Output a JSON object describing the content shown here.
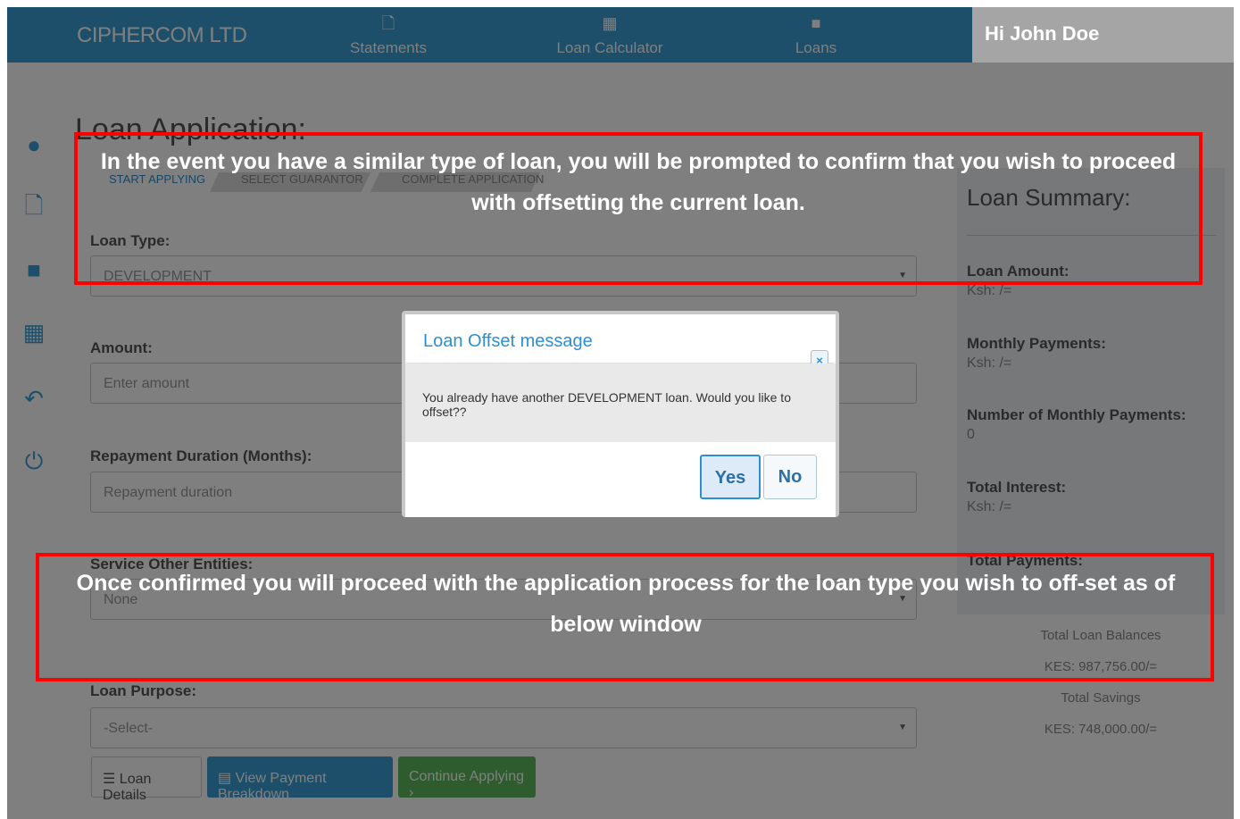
{
  "navbar": {
    "brand": "CIPHERCOM LTD",
    "items": [
      {
        "label": "Statements",
        "icon": "document-icon"
      },
      {
        "label": "Loan Calculator",
        "icon": "calculator-icon"
      },
      {
        "label": "Loans",
        "icon": "briefcase-icon"
      }
    ],
    "greeting": "Hi John Doe"
  },
  "sidebar": {
    "icons": [
      "palette-icon",
      "document-icon",
      "briefcase-icon",
      "dashboard-icon",
      "undo-icon",
      "power-icon"
    ]
  },
  "form": {
    "title": "Loan Application:",
    "steps": [
      "START APPLYING",
      "SELECT GUARANTOR",
      "COMPLETE APPLICATION"
    ],
    "loan_type_label": "Loan Type:",
    "loan_type_value": "DEVELOPMENT",
    "amount_label": "Amount:",
    "amount_placeholder": "Enter amount",
    "duration_label": "Repayment Duration (Months):",
    "duration_placeholder": "Repayment duration",
    "service_label": "Service Other Entities:",
    "service_value": "None",
    "purpose_label": "Loan Purpose:",
    "purpose_value": "-Select-",
    "buttons": {
      "loan_details": "Loan Details",
      "view_breakdown": "View Payment Breakdown",
      "continue": "Continue Applying ›"
    }
  },
  "summary": {
    "title": "Loan Summary:",
    "loan_amount_label": "Loan Amount:",
    "loan_amount_value": "Ksh: /=",
    "monthly_label": "Monthly Payments:",
    "monthly_value": "Ksh: /=",
    "count_label": "Number of Monthly Payments:",
    "count_value": "0",
    "interest_label": "Total Interest:",
    "interest_value": "Ksh: /=",
    "total_label": "Total Payments:",
    "balances_label": "Total Loan Balances",
    "balances_value": "KES: 987,756.00/=",
    "savings_label": "Total Savings",
    "savings_value": "KES: 748,000.00/="
  },
  "modal": {
    "title": "Loan Offset message",
    "close": "×",
    "message": "You already have another DEVELOPMENT loan. Would you like to offset??",
    "yes": "Yes",
    "no": "No"
  },
  "annotations": {
    "top": "In the event you have a similar type of loan, you will be prompted to  confirm that you wish to  proceed with offsetting the current loan.",
    "bottom": "Once confirmed you will proceed with the application process for the loan type you wish to off-set as of below window"
  },
  "colors": {
    "primary": "#3a9fd6",
    "annotation_border": "#ff0000",
    "modal_title": "#2e8fcf"
  }
}
